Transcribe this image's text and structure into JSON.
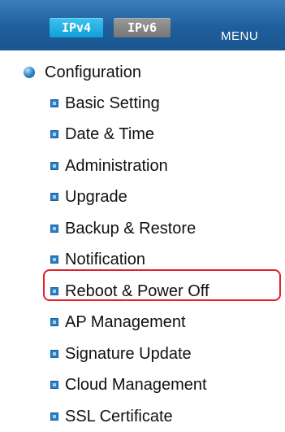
{
  "header": {
    "tabs": [
      {
        "label": "IPv4",
        "active": true
      },
      {
        "label": "IPv6",
        "active": false
      }
    ],
    "menu_label": "MENU"
  },
  "tree": {
    "section": {
      "label": "Configuration",
      "icon": "sphere-bullet-icon"
    },
    "items": [
      {
        "label": "Basic Setting"
      },
      {
        "label": "Date & Time"
      },
      {
        "label": "Administration"
      },
      {
        "label": "Upgrade"
      },
      {
        "label": "Backup & Restore"
      },
      {
        "label": "Notification"
      },
      {
        "label": "Reboot & Power Off",
        "highlighted": true
      },
      {
        "label": "AP Management"
      },
      {
        "label": "Signature Update"
      },
      {
        "label": "Cloud Management"
      },
      {
        "label": "SSL Certificate"
      }
    ]
  },
  "colors": {
    "header_bg": "#1f5e9c",
    "active_tab": "#129ed8",
    "inactive_tab": "#767676",
    "bullet": "#2a7fc9",
    "highlight": "#e0202a"
  }
}
